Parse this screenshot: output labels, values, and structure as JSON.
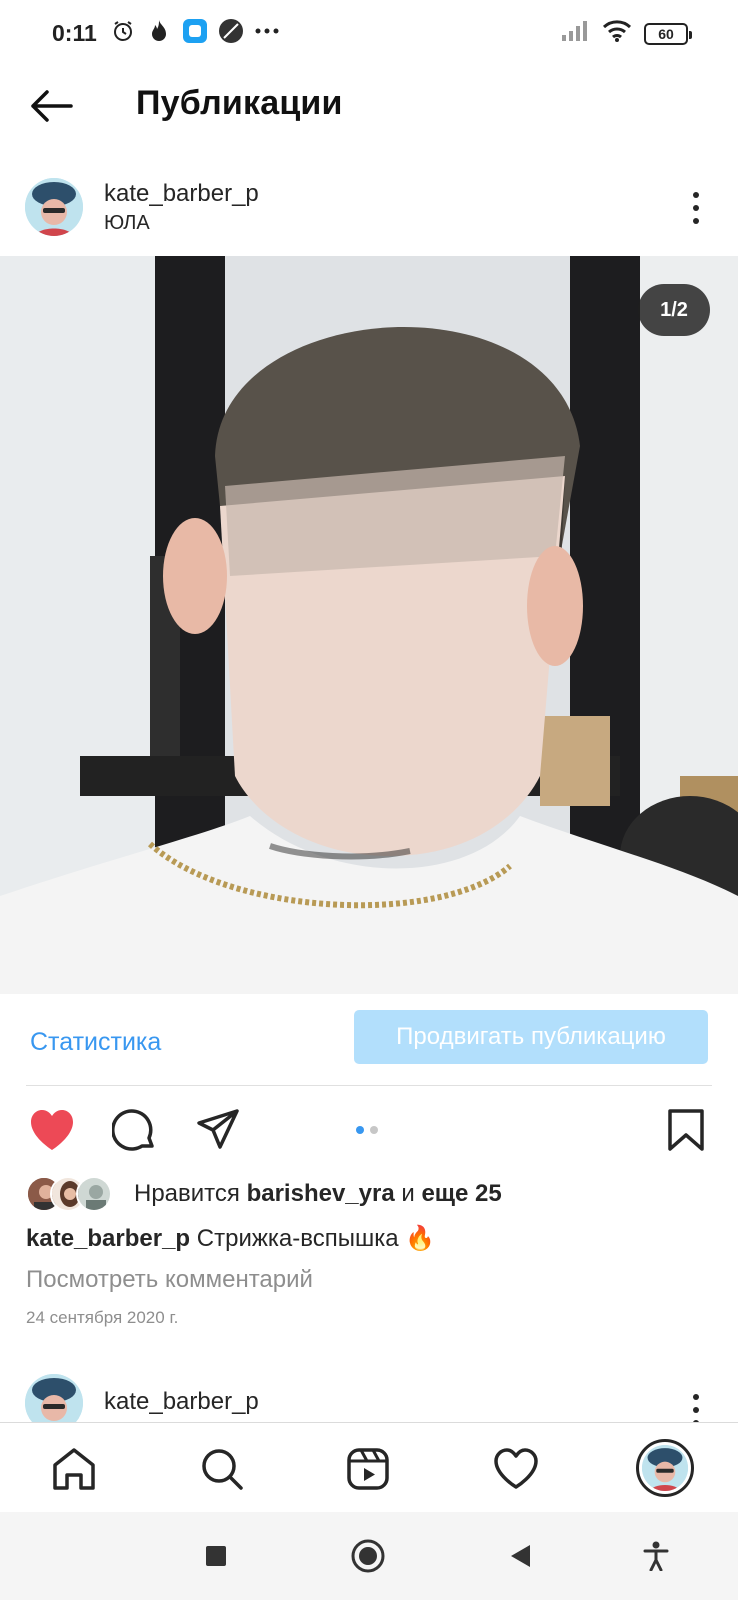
{
  "status_bar": {
    "time": "0:11",
    "battery": "60",
    "left_icons": [
      "alarm-icon",
      "fire-icon",
      "app-notification-icon",
      "compass-icon",
      "more-icon"
    ],
    "right_icons": [
      "signal-icon",
      "wifi-icon",
      "battery-icon"
    ]
  },
  "header": {
    "title": "Публикации",
    "back_icon": "arrow-left-icon"
  },
  "post": {
    "username": "kate_barber_p",
    "location": "ЮЛА",
    "photo_counter": "1/2",
    "photo_index": 1,
    "photo_count": 2,
    "stats_label": "Статистика",
    "promote_label": "Продвигать публикацию",
    "likes": {
      "prefix": "Нравится",
      "user": "barishev_yra",
      "conjunction": "и",
      "others": "еще 25"
    },
    "caption": {
      "username": "kate_barber_p",
      "text": "Стрижка-вспышка 🔥"
    },
    "view_comments": "Посмотреть комментарий",
    "date": "24 сентября 2020 г.",
    "liked": true
  },
  "next_post": {
    "username": "kate_barber_p"
  },
  "bottom_nav": {
    "items": [
      "home-icon",
      "search-icon",
      "reels-icon",
      "heart-icon",
      "profile-avatar"
    ]
  },
  "android_nav": {
    "items": [
      "recents-button",
      "home-button",
      "back-button",
      "accessibility-button"
    ]
  },
  "colors": {
    "accent": "#3897f0",
    "promote_bg": "#b2dffc",
    "like": "#ed4956",
    "text": "#262626",
    "muted": "#8e8e8e"
  }
}
